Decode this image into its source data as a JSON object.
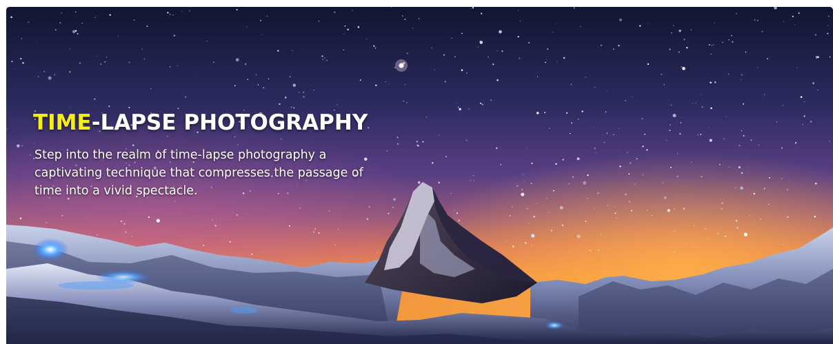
{
  "hero": {
    "title_accent": "TIME",
    "title_rest": "-LAPSE PHOTOGRAPHY",
    "description": "Step into the realm of time-lapse photography a captivating technique that compresses the passage of time into a vivid spectacle.",
    "image_subject": "starry night sky over snowy mountain peak",
    "colors": {
      "title_accent": "#f5ef12",
      "title_text": "#ffffff",
      "sky_top": "#141433",
      "sky_horizon": "#f39a3c"
    }
  }
}
